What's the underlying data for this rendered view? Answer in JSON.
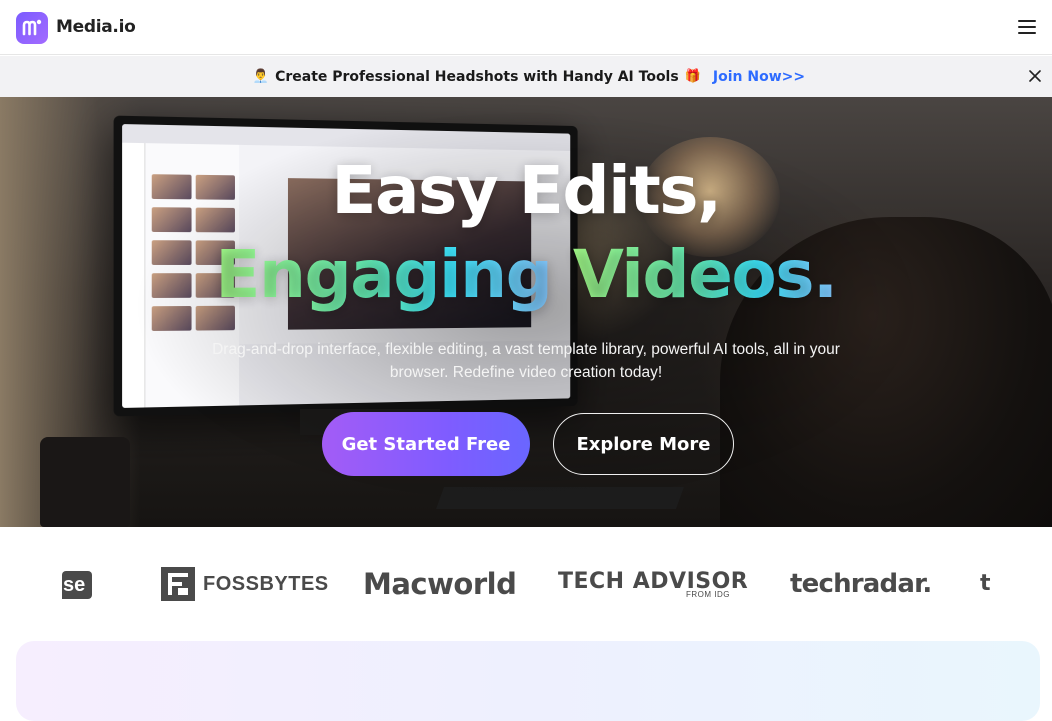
{
  "header": {
    "brand": "Media.io",
    "menu_icon": "hamburger-menu-icon",
    "brand_color": "#7b5cff"
  },
  "promo": {
    "icon_left": "headshot-emoji-icon",
    "text": "Create Professional Headshots with Handy AI Tools",
    "icon_right": "gift-icon",
    "link": "Join Now>>",
    "link_color": "#2d6bff",
    "close_icon": "close-icon"
  },
  "hero": {
    "title_line1": "Easy Edits,",
    "title_line2_a": "Engaging",
    "title_line2_b": "Videos.",
    "subtitle": "Drag-and-drop interface, flexible editing, a vast template library, powerful AI tools, all in your browser. Redefine video creation today!",
    "primary_button": "Get Started Free",
    "secondary_button": "Explore More",
    "gradient_colors": [
      "#a6ff8a",
      "#3ee8ff"
    ]
  },
  "press_logos": {
    "items": [
      {
        "name": "se-partial-logo",
        "text": "se"
      },
      {
        "name": "fossbytes-logo",
        "text": "FOSSBYTES"
      },
      {
        "name": "macworld-logo",
        "text": "Macworld"
      },
      {
        "name": "techadvisor-logo",
        "text": "TECH ADVISOR",
        "sub": "FROM IDG"
      },
      {
        "name": "techradar-logo",
        "text": "techradar."
      },
      {
        "name": "partial-logo",
        "text": "t"
      }
    ]
  }
}
